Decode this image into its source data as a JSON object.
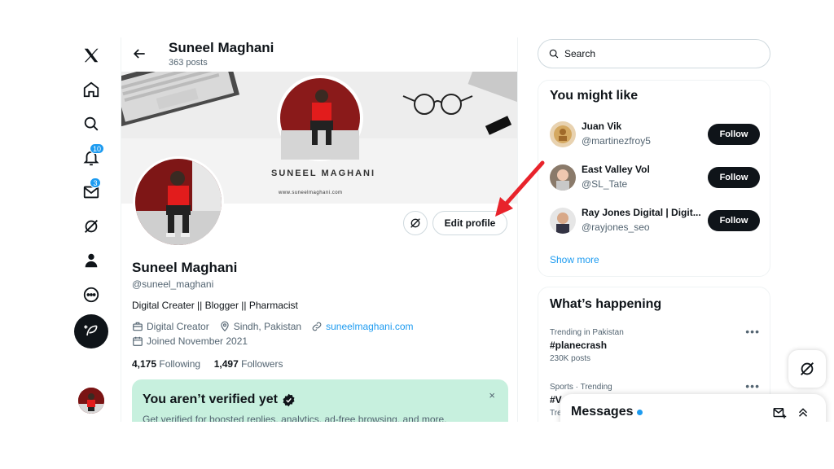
{
  "nav": {
    "notifications_badge": "10",
    "messages_badge": "3"
  },
  "header": {
    "name": "Suneel Maghani",
    "posts": "363 posts"
  },
  "banner": {
    "name": "SUNEEL MAGHANI",
    "url": "www.suneelmaghani.com"
  },
  "profile": {
    "edit_label": "Edit profile",
    "name": "Suneel Maghani",
    "handle": "@suneel_maghani",
    "bio": "Digital Creater || Blogger || Pharmacist",
    "category": "Digital Creator",
    "location": "Sindh, Pakistan",
    "website": "suneelmaghani.com",
    "joined": "Joined November 2021",
    "following_count": "4,175",
    "following_label": "Following",
    "followers_count": "1,497",
    "followers_label": "Followers"
  },
  "verify": {
    "title": "You aren’t verified yet",
    "close": "×",
    "text": "Get verified for boosted replies, analytics, ad-free browsing, and more."
  },
  "search": {
    "placeholder": "Search"
  },
  "you_might_like": {
    "title": "You might like",
    "follow_label": "Follow",
    "users": [
      {
        "name": "Juan Vik",
        "handle": "@martinezfroy5"
      },
      {
        "name": "East Valley Vol",
        "handle": "@SL_Tate"
      },
      {
        "name": "Ray Jones Digital | Digit...",
        "handle": "@rayjones_seo"
      }
    ],
    "show_more": "Show more"
  },
  "happening": {
    "title": "What’s happening",
    "trends": [
      {
        "context": "Trending in Pakistan",
        "tag": "#planecrash",
        "count": "230K posts"
      },
      {
        "context": "Sports · Trending",
        "tag": "#V",
        "count": "Tre"
      }
    ]
  },
  "messages": {
    "title": "Messages"
  },
  "colors": {
    "accent": "#1d9bf0",
    "verify_bg": "#c7f0de",
    "annotation_arrow": "#e8232b"
  }
}
